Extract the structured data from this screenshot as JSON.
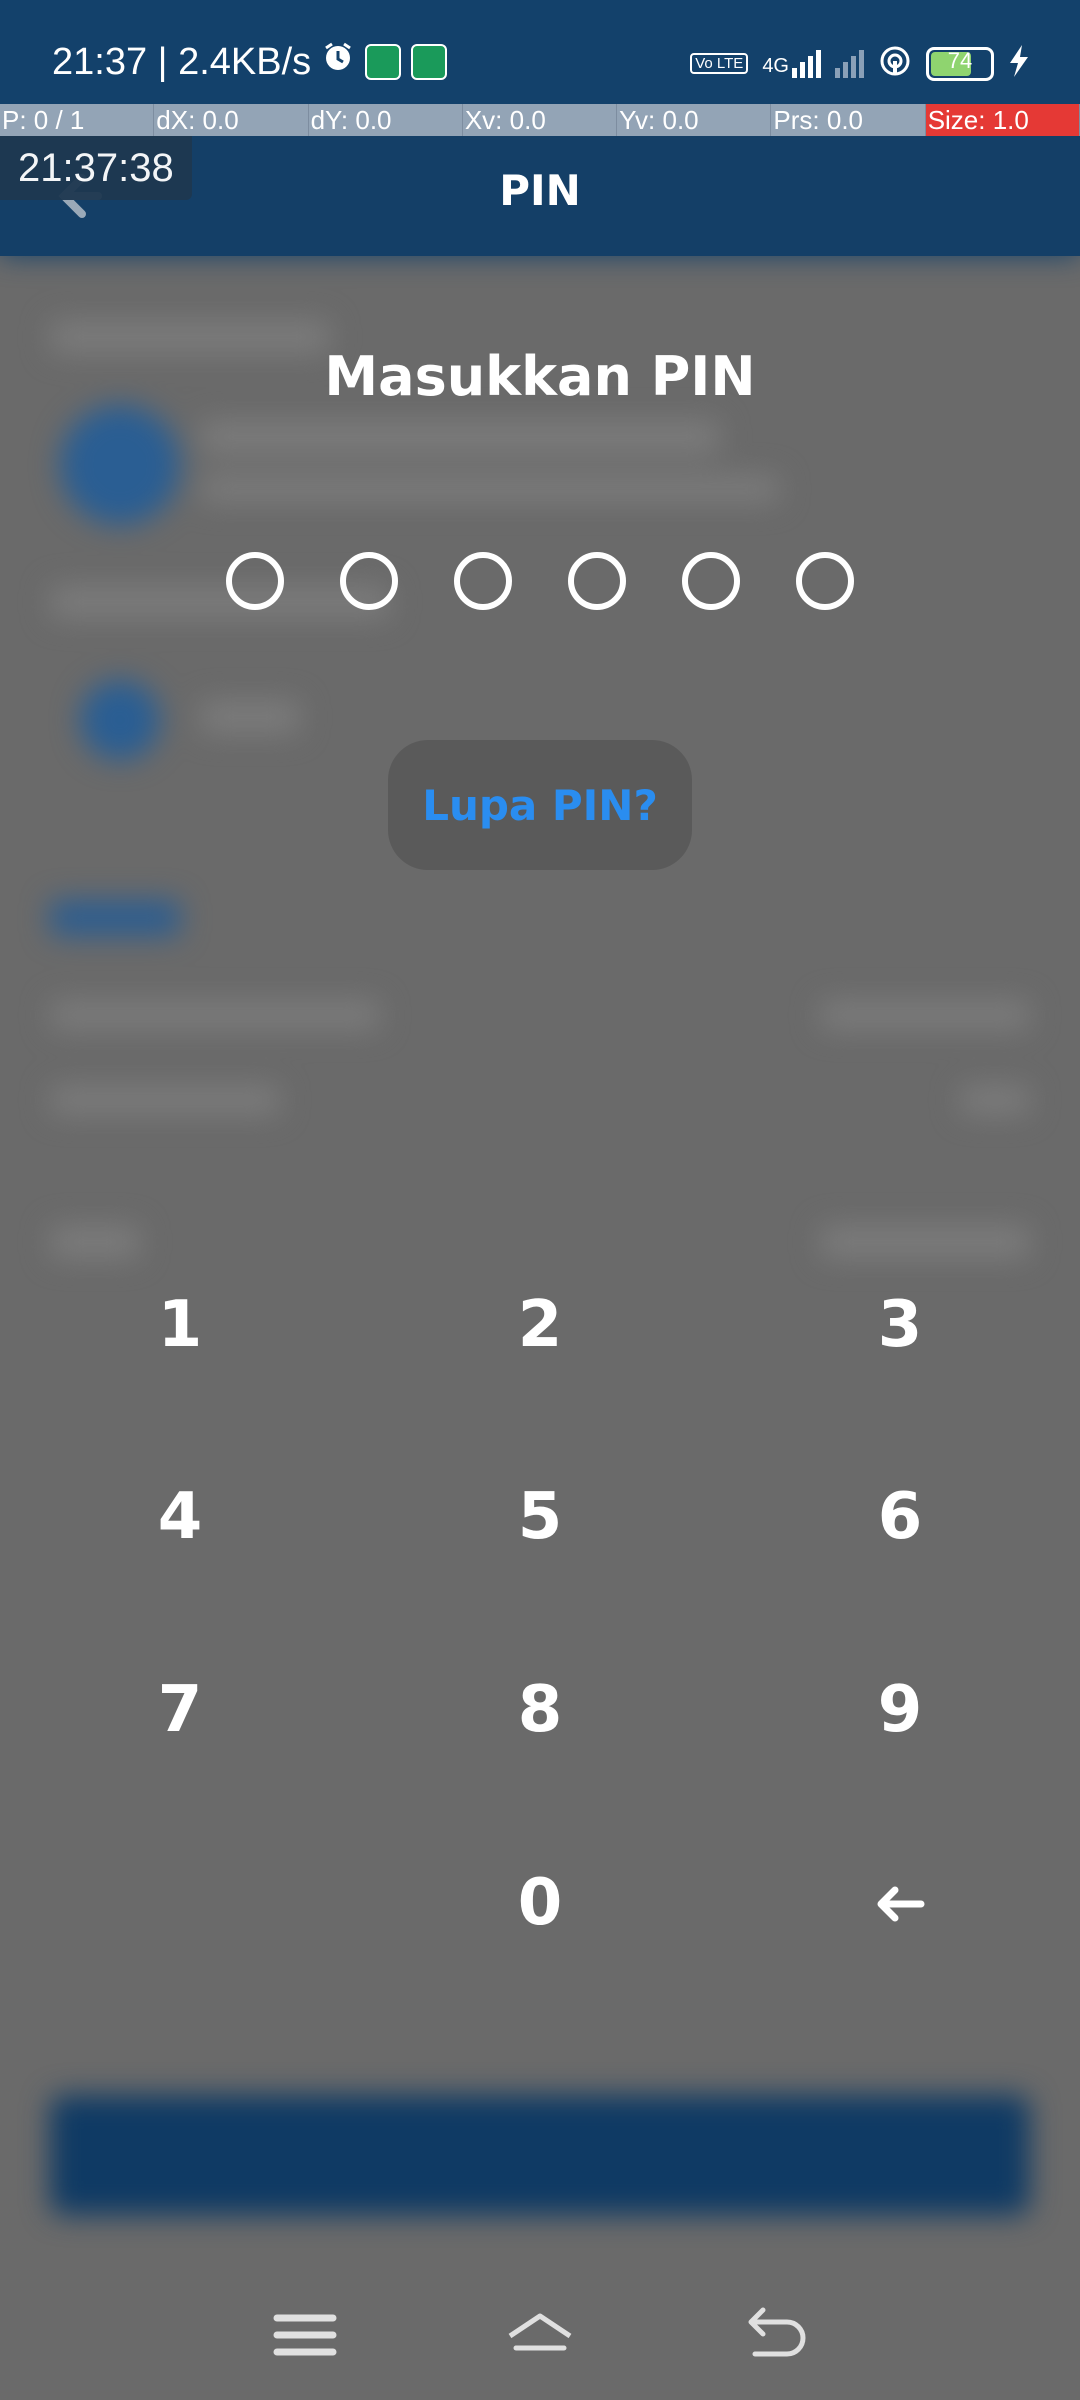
{
  "status_bar": {
    "time_speed": "21:37 | 2.4KB/s",
    "volte": "Vo LTE",
    "network": "4G",
    "battery": "74"
  },
  "debug_bar": {
    "p": "P: 0 / 1",
    "dx": "dX: 0.0",
    "dy": "dY: 0.0",
    "xv": "Xv: 0.0",
    "yv": "Yv: 0.0",
    "prs": "Prs: 0.0",
    "size": "Size: 1.0"
  },
  "clock_overlay": "21:37:38",
  "header": {
    "title": "PIN"
  },
  "pin": {
    "heading": "Masukkan PIN",
    "forgot_label": "Lupa PIN?"
  },
  "keypad": {
    "k1": "1",
    "k2": "2",
    "k3": "3",
    "k4": "4",
    "k5": "5",
    "k6": "6",
    "k7": "7",
    "k8": "8",
    "k9": "9",
    "k0": "0"
  },
  "colors": {
    "header_blue": "#143f67",
    "accent_link": "#2a8df0",
    "overlay_gray": "#6a6a6a"
  },
  "icons": {
    "back": "arrow-left-icon",
    "backspace": "backspace-arrow-icon",
    "menu": "menu-icon",
    "home": "home-icon",
    "return": "return-icon"
  }
}
